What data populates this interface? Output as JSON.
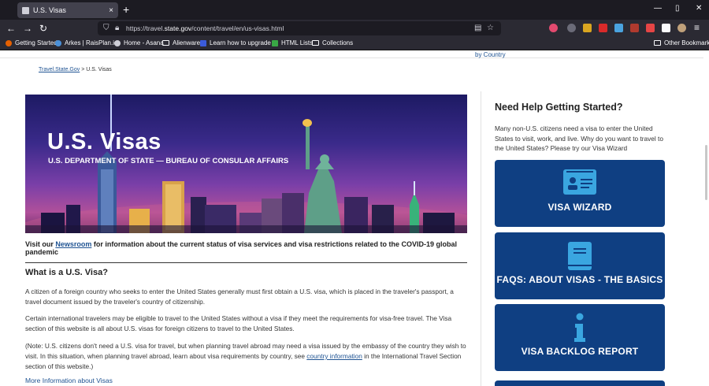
{
  "browser": {
    "tab_title": "U.S. Visas",
    "tab_close": "×",
    "new_tab": "+",
    "win_min": "—",
    "win_max": "▯",
    "win_close": "✕",
    "url_prefix": "https://travel.",
    "url_domain": "state.gov",
    "url_path": "/content/travel/en/us-visas.html",
    "bookmarks": [
      {
        "label": "Getting Started",
        "color": "#e66000"
      },
      {
        "label": "Arkes | RaisPlan.io",
        "color": "#4a90d9"
      },
      {
        "label": "Home - Asana",
        "color": "#cfcfd8"
      },
      {
        "label": "Alienware",
        "color": ""
      },
      {
        "label": "Learn how to upgrade ...",
        "color": "#3b5bdb"
      },
      {
        "label": "HTML Lists",
        "color": "#39a845"
      },
      {
        "label": "Collections",
        "color": ""
      }
    ],
    "other_bookmarks": "Other Bookmarks"
  },
  "page": {
    "top_link": "by Country",
    "breadcrumb_home": "Travel.State.Gov",
    "breadcrumb_sep": " > ",
    "breadcrumb_current": "U.S. Visas",
    "hero_title": "U.S. Visas",
    "hero_subtitle": "U.S. DEPARTMENT OF STATE — BUREAU OF CONSULAR AFFAIRS",
    "notice_pre": "Visit our ",
    "notice_link": "Newsroom",
    "notice_post": " for information about the current status of visa services and visa restrictions related to the COVID-19 global pandemic",
    "section_heading": "What is a U.S. Visa?",
    "para1": "A citizen of a foreign country who seeks to enter the United States generally must first obtain a U.S. visa, which is placed in the traveler's passport, a travel document issued by the traveler's country of citizenship.",
    "para2": "Certain international travelers may be eligible to travel to the United States without a visa if they meet the requirements for visa-free travel. The Visa section of this website is all about U.S. visas for foreign citizens to travel to the United States.",
    "para3_pre": "(Note: U.S. citizens don't need a U.S. visa for travel, but when planning travel abroad may need a visa issued by the embassy of the country they wish to visit. In this situation, when planning travel abroad, learn about visa requirements by country, see ",
    "para3_link": "country information",
    "para3_post": " in the International Travel Section section of this website.)",
    "more_link": "More Information about Visas"
  },
  "sidebar": {
    "heading": "Need Help Getting Started?",
    "text": "Many non-U.S. citizens need a visa to enter the United States to visit, work, and live. Why do you want to travel to the United States? Please try our Visa Wizard",
    "tiles": [
      {
        "label": "VISA WIZARD",
        "icon": "id-card-icon"
      },
      {
        "label": "FAQS: ABOUT VISAS - THE BASICS",
        "icon": "book-icon"
      },
      {
        "label": "VISA BACKLOG REPORT",
        "icon": "info-icon"
      }
    ]
  }
}
